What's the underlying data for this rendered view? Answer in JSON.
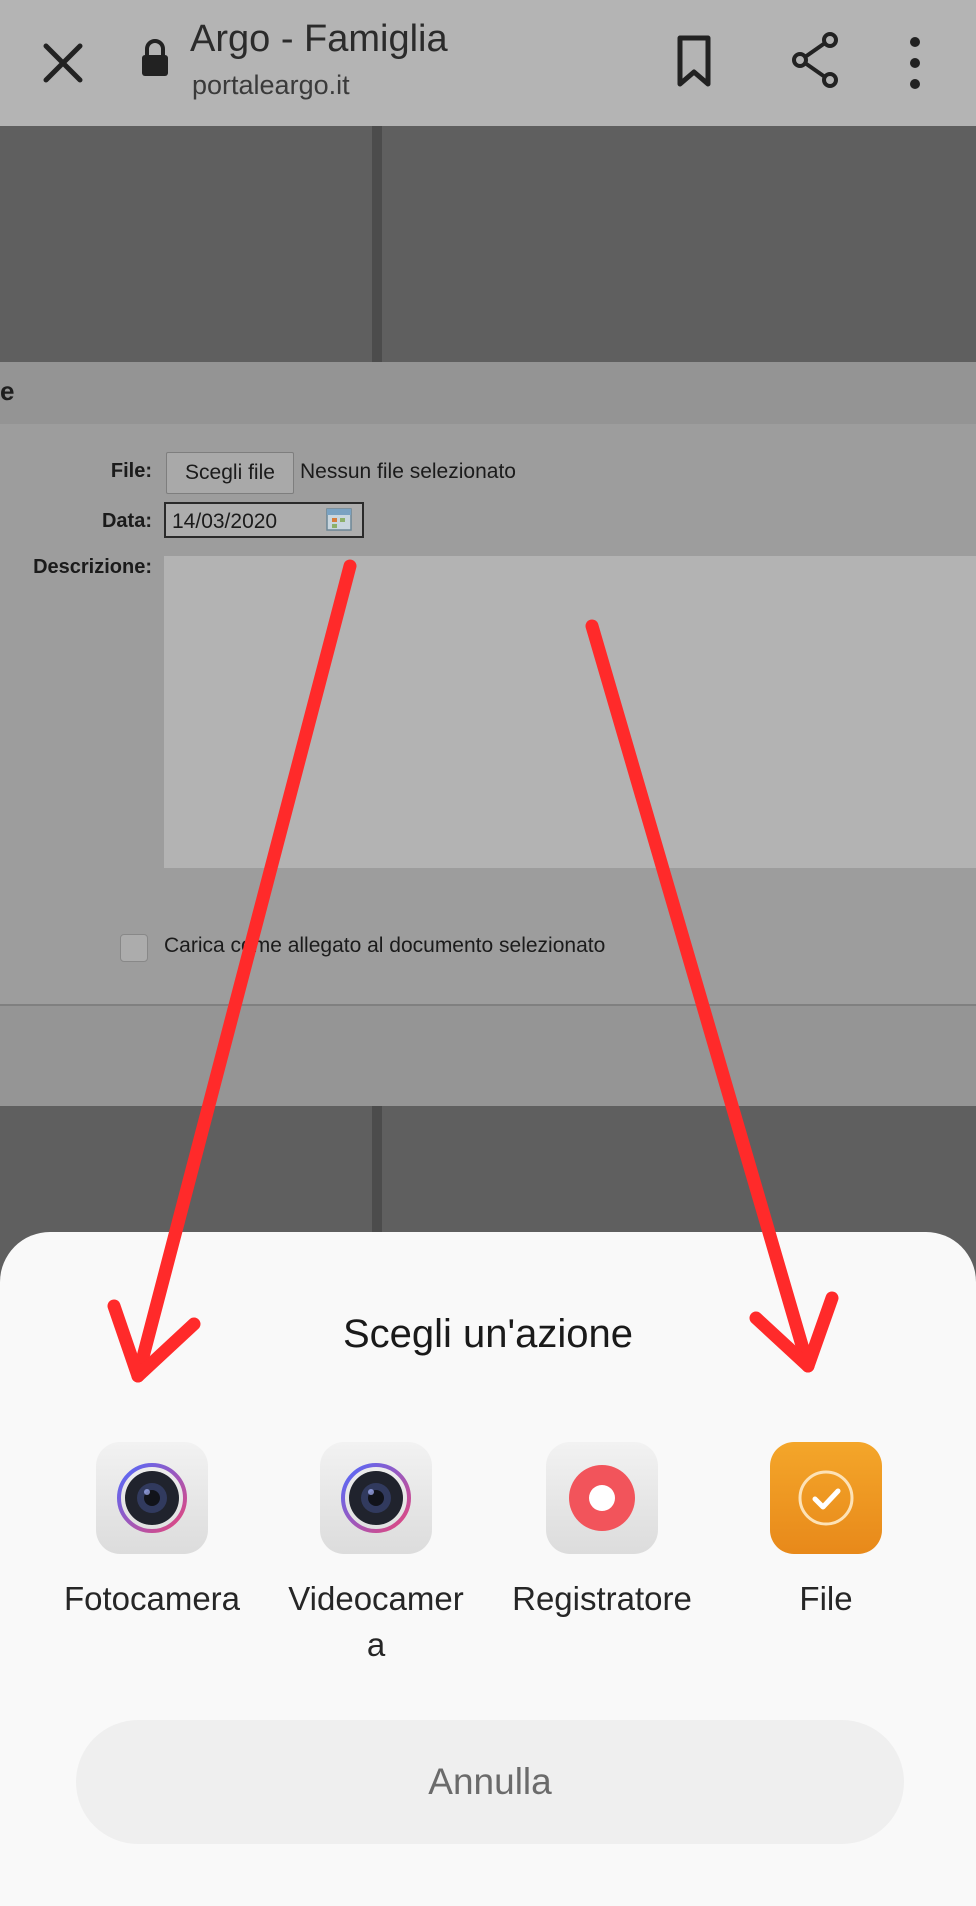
{
  "browser": {
    "title": "Argo - Famiglia",
    "url": "portaleargo.it",
    "icons": [
      "close-icon",
      "lock-icon",
      "bookmark-icon",
      "share-icon",
      "more-vert-icon"
    ]
  },
  "form": {
    "header_fragment": "e",
    "file_label": "File:",
    "choose_file_button": "Scegli file",
    "no_file_text": "Nessun file selezionato",
    "date_label": "Data:",
    "date_value": "14/03/2020",
    "description_label": "Descrizione:",
    "attach_checkbox_label": "Carica come allegato al documento selezionato"
  },
  "sheet": {
    "title": "Scegli un'azione",
    "options": [
      {
        "label": "Fotocamera",
        "icon": "camera-icon"
      },
      {
        "label": "Videocamera",
        "icon": "video-camera-icon"
      },
      {
        "label": "Registratore",
        "icon": "recorder-icon"
      },
      {
        "label": "File",
        "icon": "file-check-icon"
      }
    ],
    "cancel": "Annulla"
  },
  "colors": {
    "annotation_arrow": "#ff2a2a",
    "file_icon_bg": "#f19a1d",
    "recorder_icon": "#f2545b"
  }
}
